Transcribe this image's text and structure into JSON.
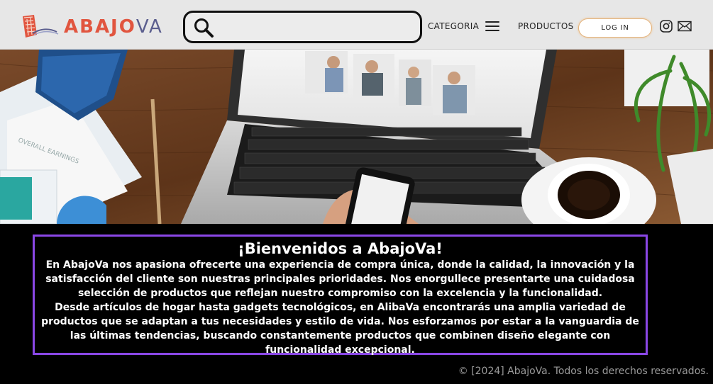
{
  "header": {
    "logo_main": "ABAJO",
    "logo_o": "",
    "logo_suffix": "VA",
    "search": {
      "placeholder": "",
      "value": ""
    },
    "nav": {
      "categoria": "CATEGORIA",
      "productos": "PRODUCTOS"
    },
    "login_label": "LOG IN",
    "icons": [
      "search-icon",
      "menu-icon",
      "instagram-icon",
      "mail-icon"
    ]
  },
  "hero": {
    "image_alt": ""
  },
  "welcome": {
    "title": "¡Bienvenidos a AbajoVa!",
    "paragraph_1": "En AbajoVa nos apasiona ofrecerte una experiencia de compra única, donde la calidad, la innovación y la satisfacción del cliente son nuestras principales prioridades. Nos enorgullece presentarte una cuidadosa selección de productos que reflejan nuestro compromiso con la excelencia y la funcionalidad.",
    "paragraph_2": "Desde artículos de hogar hasta gadgets tecnológicos, en AlibaVa encontrarás una amplia variedad de productos que se adaptan a tus necesidades y estilo de vida. Nos esforzamos por estar a la vanguardia de las últimas tendencias, buscando constantemente productos que combinen diseño elegante con funcionalidad excepcional."
  },
  "footer": {
    "copyright": "© [2024] AbajoVa. Todos los derechos reservados."
  },
  "colors": {
    "header_bg": "#e7e7e7",
    "logo_red": "#e1553f",
    "logo_orange": "#f2a73a",
    "logo_blue": "#5b5e8e",
    "accent_border": "#8a47e6",
    "page_bg": "#000000"
  }
}
